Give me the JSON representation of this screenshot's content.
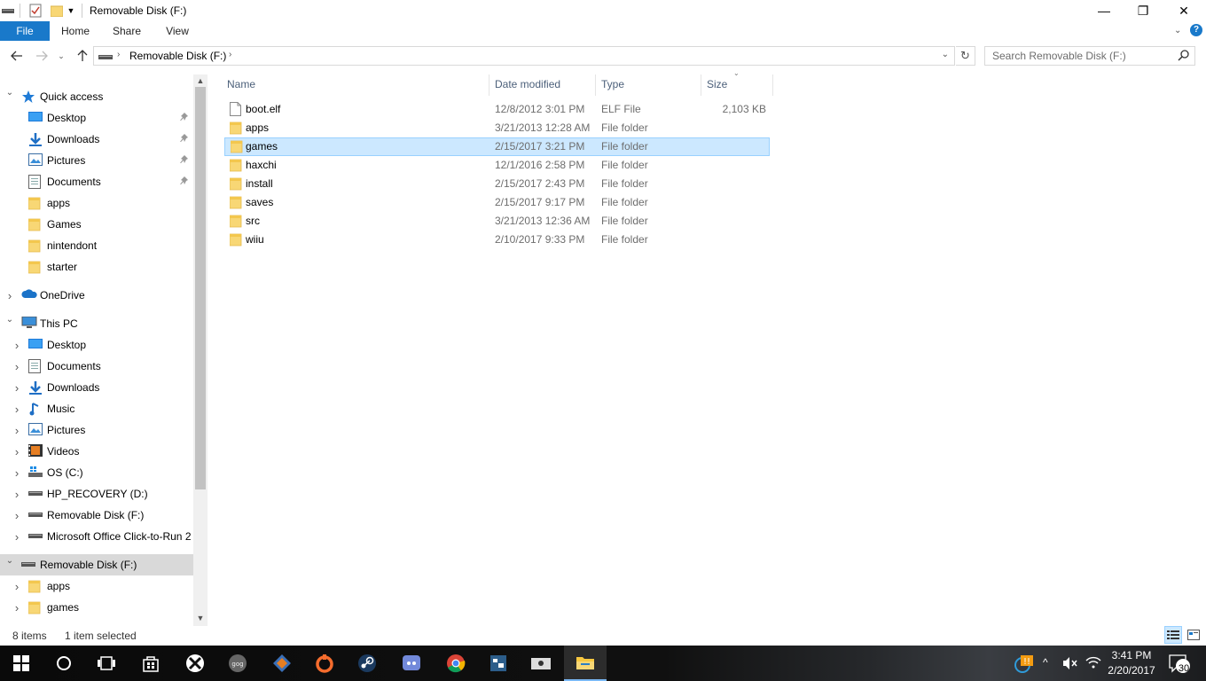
{
  "window": {
    "title": "Removable Disk (F:)",
    "minimize_glyph": "—",
    "maximize_glyph": "❐",
    "close_glyph": "✕"
  },
  "ribbon": {
    "tabs": [
      "File",
      "Home",
      "Share",
      "View"
    ],
    "help_glyph": "?"
  },
  "address": {
    "path_label": "Removable Disk (F:)",
    "search_placeholder": "Search Removable Disk (F:)"
  },
  "nav": {
    "quick_access": "Quick access",
    "quick_items": [
      {
        "label": "Desktop",
        "icon": "desktop-icon",
        "pinned": true
      },
      {
        "label": "Downloads",
        "icon": "downloads-icon",
        "pinned": true
      },
      {
        "label": "Pictures",
        "icon": "pictures-icon",
        "pinned": true
      },
      {
        "label": "Documents",
        "icon": "documents-icon",
        "pinned": true
      },
      {
        "label": "apps",
        "icon": "folder-icon",
        "pinned": false
      },
      {
        "label": "Games",
        "icon": "folder-icon",
        "pinned": false
      },
      {
        "label": "nintendont",
        "icon": "folder-icon",
        "pinned": false
      },
      {
        "label": "starter",
        "icon": "folder-icon",
        "pinned": false
      }
    ],
    "onedrive": "OneDrive",
    "this_pc": "This PC",
    "pc_items": [
      {
        "label": "Desktop",
        "icon": "desktop-icon"
      },
      {
        "label": "Documents",
        "icon": "documents-icon"
      },
      {
        "label": "Downloads",
        "icon": "downloads-icon"
      },
      {
        "label": "Music",
        "icon": "music-icon"
      },
      {
        "label": "Pictures",
        "icon": "pictures-icon"
      },
      {
        "label": "Videos",
        "icon": "videos-icon"
      },
      {
        "label": "OS (C:)",
        "icon": "windows-drive-icon"
      },
      {
        "label": "HP_RECOVERY (D:)",
        "icon": "drive-icon"
      },
      {
        "label": "Removable Disk (F:)",
        "icon": "usb-drive-icon"
      },
      {
        "label": "Microsoft Office Click-to-Run 2",
        "icon": "drive-icon"
      }
    ],
    "removable": "Removable Disk (F:)",
    "removable_items": [
      {
        "label": "apps"
      },
      {
        "label": "games"
      }
    ]
  },
  "columns": {
    "name": "Name",
    "date": "Date modified",
    "type": "Type",
    "size": "Size"
  },
  "files": [
    {
      "name": "boot.elf",
      "date": "12/8/2012 3:01 PM",
      "type": "ELF File",
      "size": "2,103 KB",
      "kind": "file"
    },
    {
      "name": "apps",
      "date": "3/21/2013 12:28 AM",
      "type": "File folder",
      "size": "",
      "kind": "folder"
    },
    {
      "name": "games",
      "date": "2/15/2017 3:21 PM",
      "type": "File folder",
      "size": "",
      "kind": "folder",
      "selected": true
    },
    {
      "name": "haxchi",
      "date": "12/1/2016 2:58 PM",
      "type": "File folder",
      "size": "",
      "kind": "folder"
    },
    {
      "name": "install",
      "date": "2/15/2017 2:43 PM",
      "type": "File folder",
      "size": "",
      "kind": "folder"
    },
    {
      "name": "saves",
      "date": "2/15/2017 9:17 PM",
      "type": "File folder",
      "size": "",
      "kind": "folder"
    },
    {
      "name": "src",
      "date": "3/21/2013 12:36 AM",
      "type": "File folder",
      "size": "",
      "kind": "folder"
    },
    {
      "name": "wiiu",
      "date": "2/10/2017 9:33 PM",
      "type": "File folder",
      "size": "",
      "kind": "folder"
    }
  ],
  "status": {
    "items": "8 items",
    "selected": "1 item selected"
  },
  "taskbar": {
    "time": "3:41 PM",
    "date": "2/20/2017",
    "notifications": "30",
    "apps": [
      "start-icon",
      "cortana-icon",
      "task-view-icon",
      "store-icon",
      "xbox-icon",
      "gog-galaxy-icon",
      "app-icon",
      "origin-icon",
      "steam-icon",
      "discord-icon",
      "chrome-icon",
      "app-icon",
      "app-icon",
      "file-explorer-icon"
    ]
  },
  "colors": {
    "accent": "#1979ca",
    "selection": "#cce8ff",
    "selection_border": "#99d1ff",
    "folder": "#f8d775",
    "header_text": "#4c607a"
  }
}
